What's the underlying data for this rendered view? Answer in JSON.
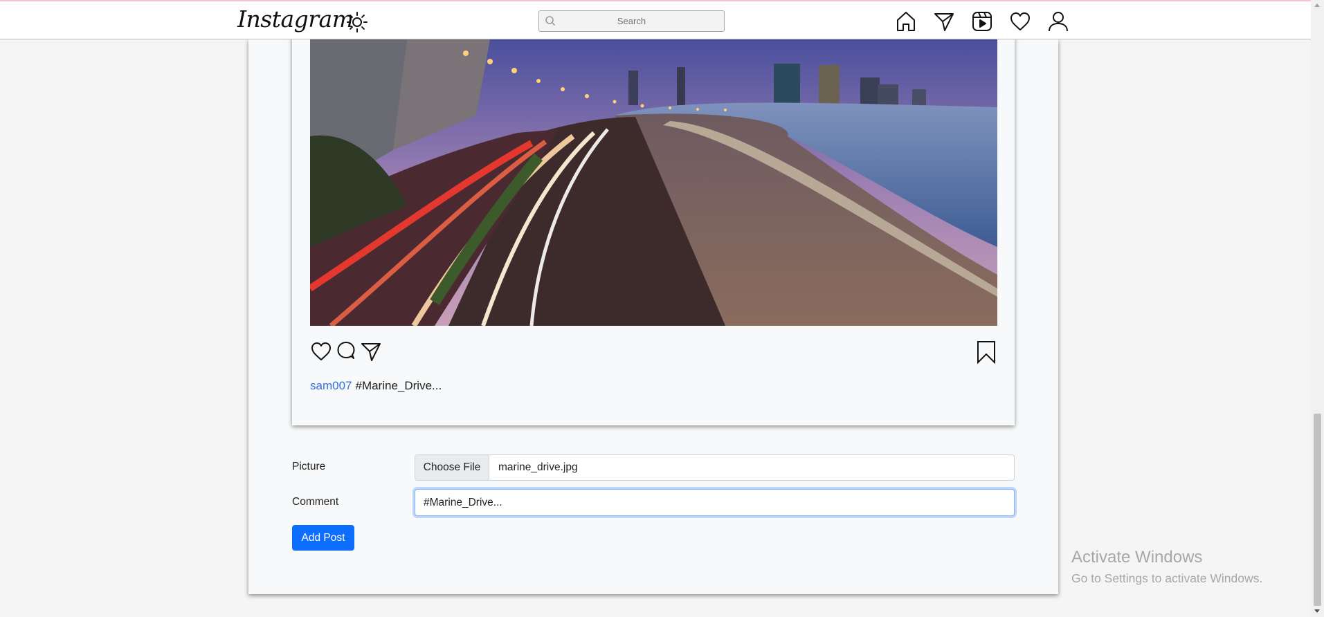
{
  "navbar": {
    "logo": "Instagram",
    "search": {
      "placeholder": "Search",
      "value": ""
    },
    "icons": [
      "theme-toggle-icon",
      "home-icon",
      "send-icon",
      "reels-icon",
      "heart-icon",
      "profile-icon"
    ]
  },
  "post": {
    "image_alt": "Marine Drive at night",
    "username": "sam007",
    "caption": "#Marine_Drive..."
  },
  "form": {
    "picture_label": "Picture",
    "choose_file_label": "Choose File",
    "file_name": "marine_drive.jpg",
    "comment_label": "Comment",
    "comment_value": "#Marine_Drive...",
    "submit_label": "Add Post"
  },
  "watermark": {
    "title": "Activate Windows",
    "subtitle": "Go to Settings to activate Windows."
  },
  "colors": {
    "link": "#2f6fe0",
    "primary_button": "#0d6efd",
    "focus_border": "#86b7fe"
  }
}
